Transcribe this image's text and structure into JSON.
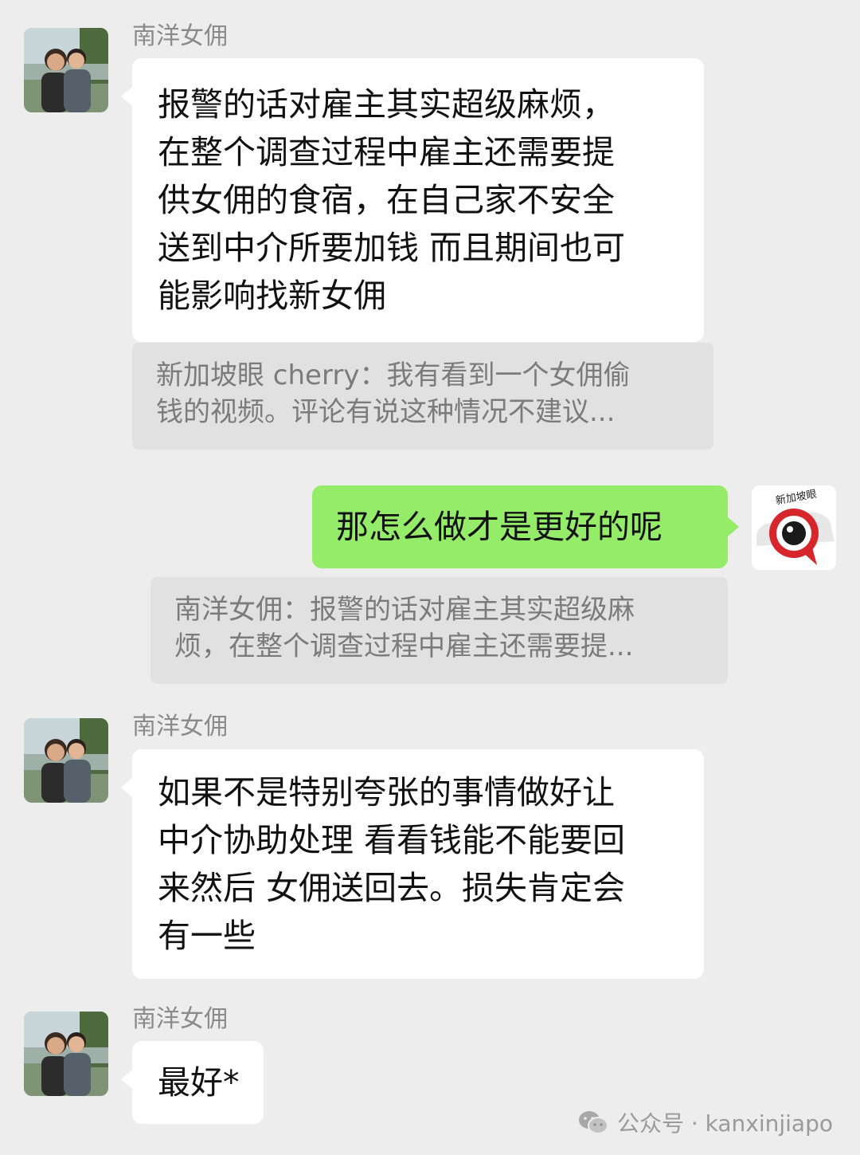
{
  "messages": {
    "msg1": {
      "sender": "南洋女佣",
      "lines": [
        "报警的话对雇主其实超级麻烦，",
        "在整个调查过程中雇主还需要提",
        "供女佣的食宿，在自己家不安全",
        "送到中介所要加钱 而且期间也可",
        "能影响找新女佣"
      ],
      "quote_lines": [
        "新加坡眼 cherry：我有看到一个女佣偷",
        "钱的视频。评论有说这种情况不建议..."
      ]
    },
    "msg2": {
      "text": "那怎么做才是更好的呢",
      "quote_lines": [
        "南洋女佣：报警的话对雇主其实超级麻",
        "烦，在整个调查过程中雇主还需要提..."
      ],
      "avatar_label": "新加坡眼"
    },
    "msg3": {
      "sender": "南洋女佣",
      "lines": [
        "如果不是特别夸张的事情做好让",
        "中介协助处理 看看钱能不能要回",
        "来然后 女佣送回去。损失肯定会",
        "有一些"
      ]
    },
    "msg4": {
      "sender": "南洋女佣",
      "text": "最好*"
    }
  },
  "watermark": {
    "text": "公众号 · kanxinjiapo"
  }
}
